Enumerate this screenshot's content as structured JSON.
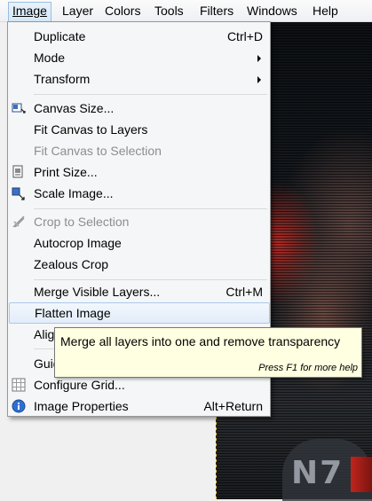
{
  "menubar": {
    "items": [
      {
        "label": "Image",
        "mnemonic_index": 0,
        "active": true
      },
      {
        "label": "Layer",
        "mnemonic_index": 0
      },
      {
        "label": "Colors",
        "mnemonic_index": 0
      },
      {
        "label": "Tools",
        "mnemonic_index": 0
      },
      {
        "label": "Filters",
        "mnemonic_index": 4
      },
      {
        "label": "Windows",
        "mnemonic_index": 0
      },
      {
        "label": "Help",
        "mnemonic_index": 0
      }
    ]
  },
  "image_menu": {
    "items": [
      {
        "label": "Duplicate",
        "accel": "Ctrl+D",
        "icon": "none"
      },
      {
        "label": "Mode",
        "submenu": true
      },
      {
        "label": "Transform",
        "submenu": true
      },
      {
        "label": "Canvas Size...",
        "icon": "canvas-size-icon"
      },
      {
        "label": "Fit Canvas to Layers"
      },
      {
        "label": "Fit Canvas to Selection",
        "disabled": true
      },
      {
        "label": "Print Size...",
        "icon": "print-size-icon"
      },
      {
        "label": "Scale Image...",
        "icon": "scale-image-icon"
      },
      {
        "label": "Crop to Selection",
        "disabled": true,
        "icon": "crop-icon"
      },
      {
        "label": "Autocrop Image"
      },
      {
        "label": "Zealous Crop"
      },
      {
        "label": "Merge Visible Layers...",
        "accel": "Ctrl+M"
      },
      {
        "label": "Flatten Image",
        "highlighted": true
      },
      {
        "label": "Align Visible Layers..."
      },
      {
        "label": "Guides",
        "submenu": true
      },
      {
        "label": "Configure Grid...",
        "icon": "grid-icon"
      },
      {
        "label": "Image Properties",
        "accel": "Alt+Return",
        "icon": "info-icon"
      }
    ],
    "visible_labels": {
      "align_partial": "Align Visible L",
      "guides_partial": "Guid"
    }
  },
  "tooltip": {
    "text": "Merge all layers into one and remove transparency",
    "help": "Press F1 for more help"
  },
  "canvas": {
    "badge_text": "N7"
  },
  "colors": {
    "menu_bg": "#f5f6f7",
    "highlight_border": "#aac9ec",
    "tooltip_bg": "#ffffe1",
    "disabled_text": "#8d8d8d",
    "info_icon_blue": "#2f6fd0"
  }
}
